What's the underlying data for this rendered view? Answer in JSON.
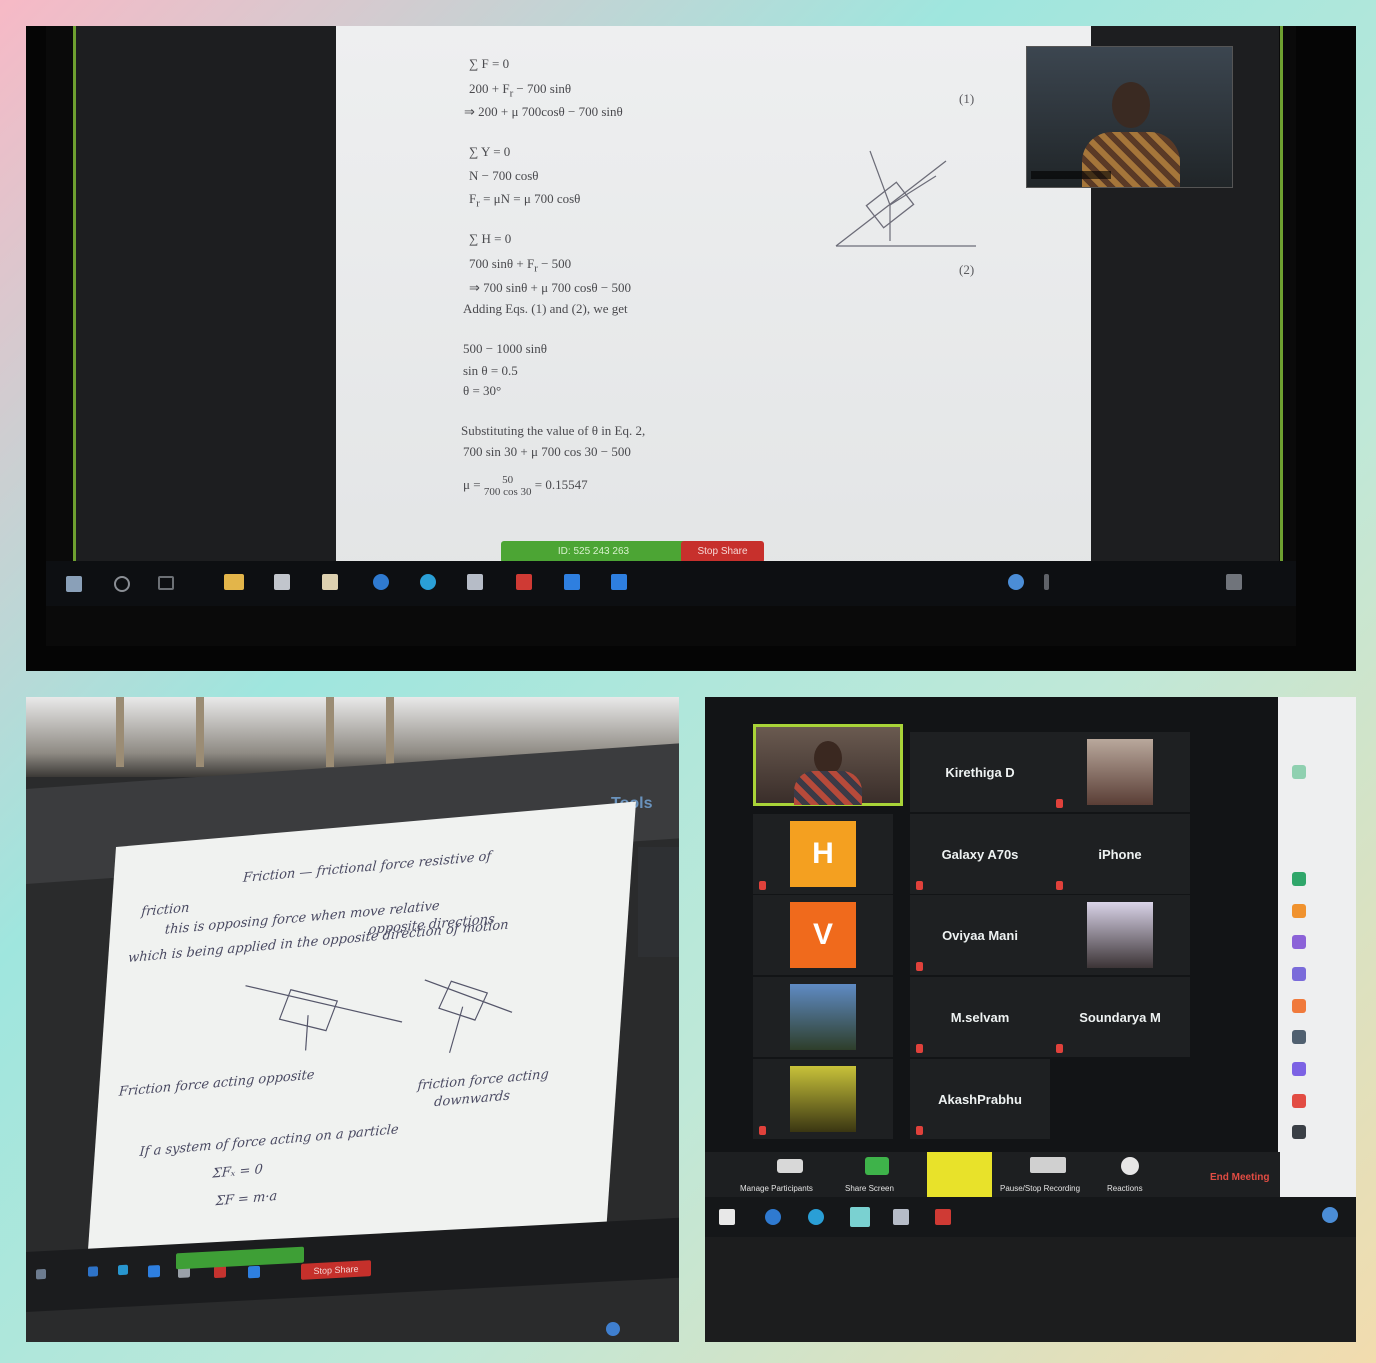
{
  "top_photo": {
    "stop_share": "Stop Share",
    "share_status": "ID: 525 243 263"
  },
  "bottom_left_photo": {
    "tools_tab": "Tools",
    "stop_share": "Stop Share"
  },
  "bottom_right_photo": {
    "participants": [
      {
        "label": "Kirethiga D"
      },
      {
        "label": "Galaxy A70s"
      },
      {
        "label": "iPhone"
      },
      {
        "label": "Oviyaa Mani"
      },
      {
        "label": "M.selvam"
      },
      {
        "label": "Soundarya M"
      },
      {
        "label": "AkashPrabhu"
      }
    ],
    "avatars": [
      {
        "letter": "H",
        "color": "#f4a020"
      },
      {
        "letter": "V",
        "color": "#f06a1c"
      }
    ],
    "controls": {
      "manage_participants": "Manage Participants",
      "share_screen": "Share Screen",
      "pause_recording": "Pause/Stop Recording",
      "reactions": "Reactions",
      "end_meeting": "End Meeting"
    }
  }
}
